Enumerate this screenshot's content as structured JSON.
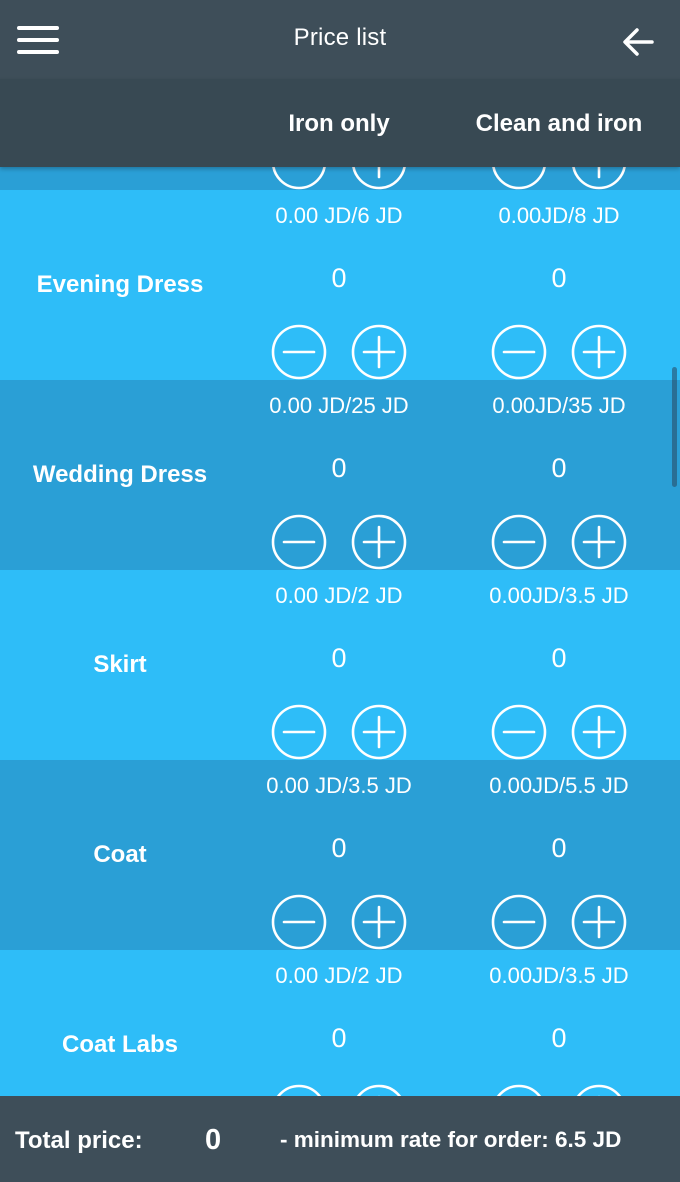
{
  "header": {
    "title": "Price list"
  },
  "columns": {
    "iron_only": "Iron only",
    "clean_and_iron": "Clean and iron"
  },
  "items": [
    {
      "name": "",
      "iron_price": "",
      "iron_qty": "",
      "clean_price": "",
      "clean_qty": ""
    },
    {
      "name": "Evening Dress",
      "iron_price": "0.00 JD/6 JD",
      "iron_qty": "0",
      "clean_price": "0.00JD/8 JD",
      "clean_qty": "0"
    },
    {
      "name": "Wedding Dress",
      "iron_price": "0.00 JD/25 JD",
      "iron_qty": "0",
      "clean_price": "0.00JD/35 JD",
      "clean_qty": "0"
    },
    {
      "name": "Skirt",
      "iron_price": "0.00 JD/2 JD",
      "iron_qty": "0",
      "clean_price": "0.00JD/3.5 JD",
      "clean_qty": "0"
    },
    {
      "name": "Coat",
      "iron_price": "0.00 JD/3.5 JD",
      "iron_qty": "0",
      "clean_price": "0.00JD/5.5 JD",
      "clean_qty": "0"
    },
    {
      "name": "Coat Labs",
      "iron_price": "0.00 JD/2 JD",
      "iron_qty": "0",
      "clean_price": "0.00JD/3.5 JD",
      "clean_qty": "0"
    }
  ],
  "footer": {
    "total_label": "Total price:",
    "total_value": "0",
    "min_rate": "- minimum rate for order: 6.5 JD"
  },
  "icons": {
    "menu": "hamburger-menu-icon",
    "back": "arrow-left-icon",
    "minus": "minus-circle-icon",
    "plus": "plus-circle-icon"
  },
  "colors": {
    "bar_bg": "#3e4e59",
    "header_bg": "#384953",
    "row_light": "#2ebdf8",
    "row_dark": "#2a9fd6",
    "text": "#ffffff"
  }
}
